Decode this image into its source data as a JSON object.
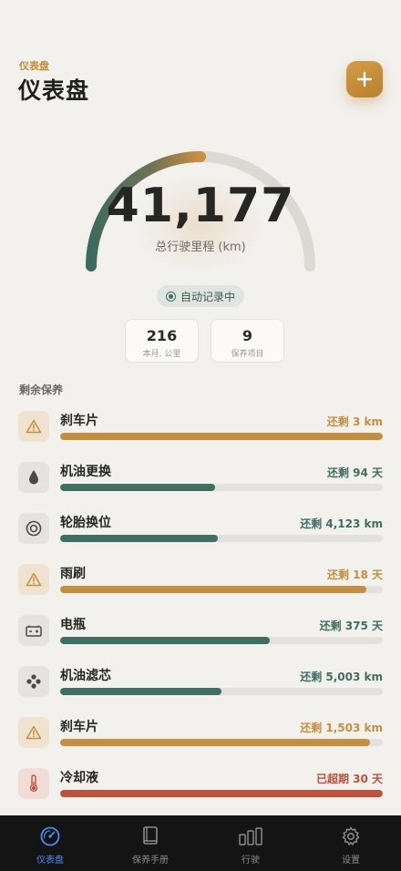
{
  "header": {
    "subtitle": "仪表盘",
    "title": "仪表盘",
    "add_icon": "plus-icon"
  },
  "gauge": {
    "value": "41,177",
    "label": "总行驶里程 (km)",
    "progress": 0.5
  },
  "auto_record": {
    "label": "自动记录中"
  },
  "stats": [
    {
      "value": "216",
      "label": "本月, 公里"
    },
    {
      "value": "9",
      "label": "保养项目"
    }
  ],
  "section_title": "剩余保养",
  "items": [
    {
      "name": "刹车片",
      "remain": "还剩 3 km",
      "progress": 1.0,
      "status": "warning",
      "icon": "warning-icon"
    },
    {
      "name": "机油更换",
      "remain": "还剩 94 天",
      "progress": 0.48,
      "status": "ok",
      "icon": "oil-drop-icon"
    },
    {
      "name": "轮胎换位",
      "remain": "还剩 4,123 km",
      "progress": 0.485,
      "status": "ok",
      "icon": "tire-icon"
    },
    {
      "name": "雨刷",
      "remain": "还剩 18 天",
      "progress": 0.95,
      "status": "warning",
      "icon": "warning-icon"
    },
    {
      "name": "电瓶",
      "remain": "还剩 375 天",
      "progress": 0.65,
      "status": "ok",
      "icon": "battery-icon"
    },
    {
      "name": "机油滤芯",
      "remain": "还剩 5,003 km",
      "progress": 0.5,
      "status": "ok",
      "icon": "filter-icon"
    },
    {
      "name": "刹车片",
      "remain": "还剩 1,503 km",
      "progress": 0.96,
      "status": "warning",
      "icon": "warning-icon"
    },
    {
      "name": "冷却液",
      "remain": "已超期 30 天",
      "progress": 1.0,
      "status": "overdue",
      "icon": "thermometer-icon"
    }
  ],
  "colors": {
    "warning": "#c68f3f",
    "ok": "#3f6e62",
    "overdue": "#c0503c",
    "accent": "#c58a32",
    "tab_active": "#4a8ef0"
  },
  "tabs": [
    {
      "label": "仪表盘",
      "icon": "gauge-icon",
      "active": true
    },
    {
      "label": "保养手册",
      "icon": "book-icon",
      "active": false
    },
    {
      "label": "行驶",
      "icon": "bar-chart-icon",
      "active": false
    },
    {
      "label": "设置",
      "icon": "gear-icon",
      "active": false
    }
  ]
}
